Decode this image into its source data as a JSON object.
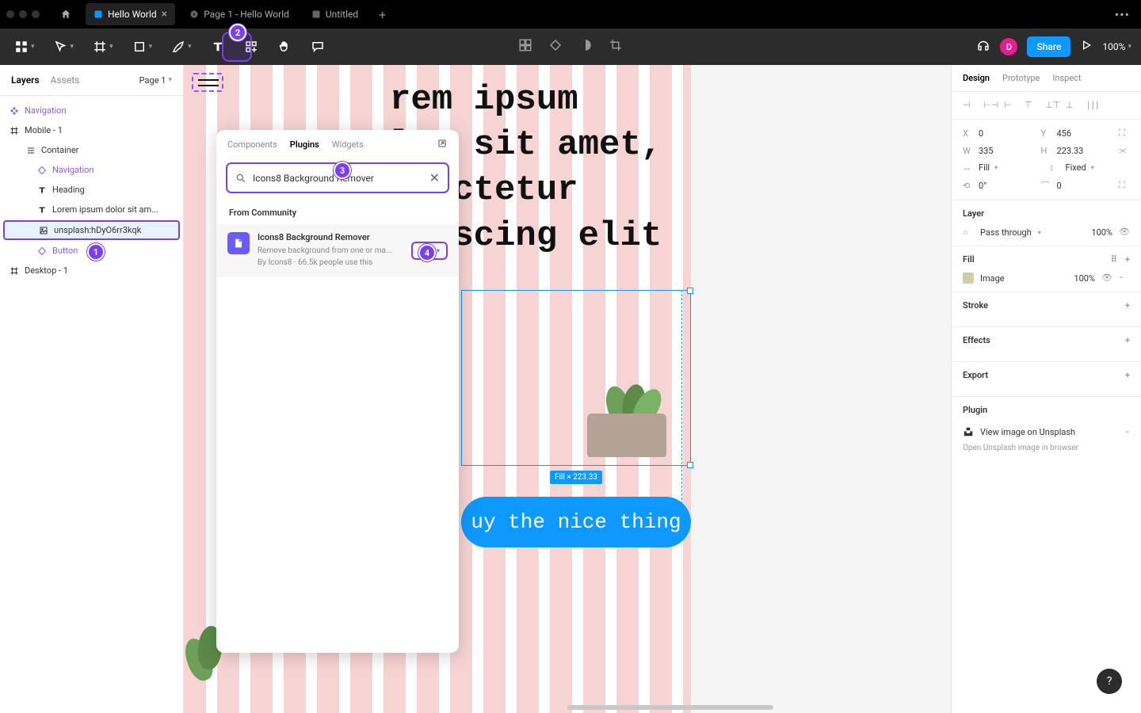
{
  "titlebar": {
    "tabs": [
      {
        "label": "Hello World",
        "active": true
      },
      {
        "label": "Page 1 - Hello World",
        "active": false
      },
      {
        "label": "Untitled",
        "active": false
      }
    ]
  },
  "toolbar": {
    "share": "Share",
    "avatar": "D",
    "zoom": "100%"
  },
  "left": {
    "tabs": {
      "layers": "Layers",
      "assets": "Assets"
    },
    "page": "Page 1",
    "tree": {
      "navigation": "Navigation",
      "mobile": "Mobile - 1",
      "container": "Container",
      "nav2": "Navigation",
      "heading": "Heading",
      "lorem": "Lorem ipsum dolor sit am...",
      "image": "unsplash:hDyO6rr3kqk",
      "button": "Button",
      "desktop": "Desktop - 1"
    }
  },
  "popup": {
    "tabs": {
      "components": "Components",
      "plugins": "Plugins",
      "widgets": "Widgets"
    },
    "search": "Icons8 Background Remover",
    "community": "From Community",
    "result": {
      "title": "Icons8 Background Remover",
      "sub1": "Remove background from one or ma...",
      "sub2": "By Icons8 · 66.5k people use this",
      "run": "Run"
    }
  },
  "canvas": {
    "text": "rem ipsum\nlor sit amet,\nnsectetur\nipiscing elit",
    "size_tag": "Fill × 223.33",
    "cta": "uy the nice thing"
  },
  "right": {
    "tabs": {
      "design": "Design",
      "prototype": "Prototype",
      "inspect": "Inspect"
    },
    "x": "0",
    "y": "456",
    "w": "335",
    "h": "223.33",
    "fillmode": "Fill",
    "fixed": "Fixed",
    "rot": "0°",
    "radius": "0",
    "layer": {
      "title": "Layer",
      "mode": "Pass through",
      "opacity": "100%"
    },
    "fill": {
      "title": "Fill",
      "type": "Image",
      "opacity": "100%"
    },
    "stroke": "Stroke",
    "effects": "Effects",
    "export": "Export",
    "plugin": {
      "title": "Plugin",
      "link": "View image on Unsplash",
      "sub": "Open Unsplash image in browser"
    }
  },
  "callouts": {
    "c1": "1",
    "c2": "2",
    "c3": "3",
    "c4": "4"
  }
}
